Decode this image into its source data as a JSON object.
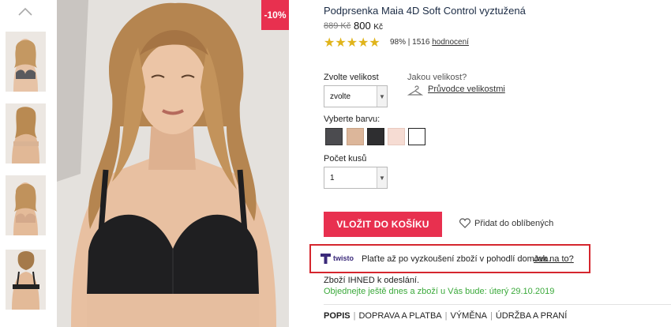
{
  "gallery": {
    "up_icon": "chevron-up-icon",
    "thumbnails": [
      "thumbnail-1",
      "thumbnail-2",
      "thumbnail-3",
      "thumbnail-4"
    ]
  },
  "badge": {
    "discount": "-10%"
  },
  "product": {
    "title": "Podprsenka Maia 4D Soft Control vyztužená",
    "old_price": "889 Kč",
    "new_price": "800",
    "currency": "Kč",
    "stars": "★★★★★",
    "rating_percent": "98%",
    "rating_sep": " | ",
    "rating_count": "1516",
    "rating_link": "hodnocení"
  },
  "size": {
    "label": "Zvolte velikost",
    "selected": "zvolte",
    "help_question": "Jakou velikost?",
    "guide_link": "Průvodce velikostmi"
  },
  "color": {
    "label": "Vyberte barvu:",
    "swatches": [
      "#4b4b4f",
      "#dcb69a",
      "#2e2e30",
      "#f6dcd3",
      "#ffffff"
    ]
  },
  "quantity": {
    "label": "Počet kusů",
    "value": "1"
  },
  "actions": {
    "add_to_cart": "VLOŽIT DO KOŠÍKU",
    "favorites": "Přidat do oblíbených"
  },
  "twisto": {
    "brand": "twisto",
    "message": "Plaťte až po vyzkoušení zboží v pohodlí domova.",
    "link": "Jak na to?"
  },
  "availability": {
    "stock": "Zboží IHNED k odeslání.",
    "delivery": "Objednejte ještě dnes a zboží u Vás bude: úterý 29.10.2019"
  },
  "tabs": [
    "POPIS",
    "DOPRAVA A PLATBA",
    "VÝMĚNA",
    "ÚDRŽBA A PRANÍ"
  ],
  "colors": {
    "accent": "#e8304f",
    "highlight": "#d5262e",
    "star": "#e0b41b",
    "success": "#3aa93a"
  }
}
